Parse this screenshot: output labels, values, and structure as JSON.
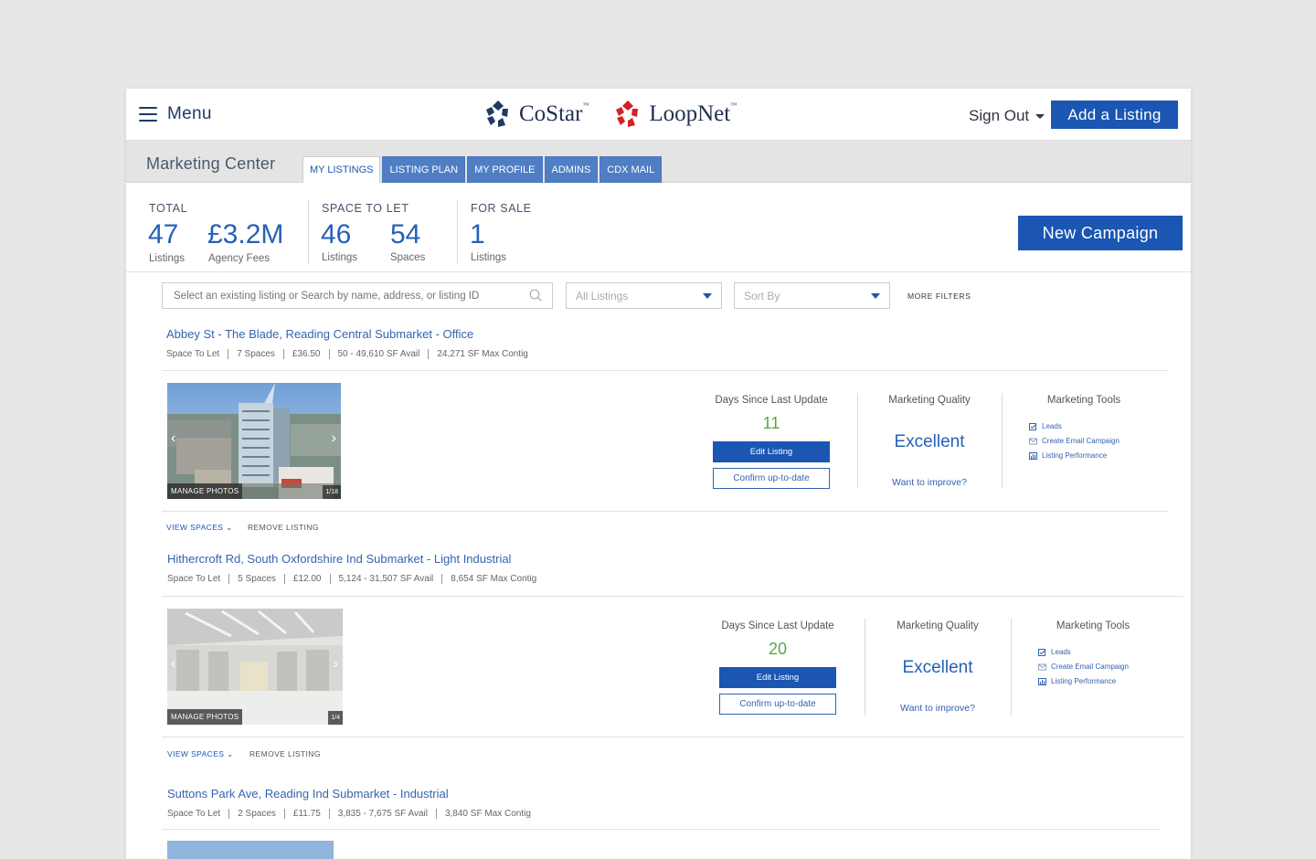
{
  "nav": {
    "menu_label": "Menu",
    "brand_costar": "CoStar",
    "brand_loopnet": "LoopNet",
    "tm": "™",
    "sign_out": "Sign Out",
    "add_listing": "Add a Listing"
  },
  "marketing_center": {
    "title": "Marketing Center",
    "tabs": [
      {
        "label": "MY LISTINGS",
        "active": true
      },
      {
        "label": "LISTING PLAN",
        "active": false
      },
      {
        "label": "MY PROFILE",
        "active": false
      },
      {
        "label": "ADMINS",
        "active": false
      },
      {
        "label": "CDX MAIL",
        "active": false
      }
    ]
  },
  "stats": {
    "total_label": "TOTAL",
    "total_listings": "47",
    "total_listings_label": "Listings",
    "agency_fees": "£3.2M",
    "agency_fees_label": "Agency Fees",
    "space_label": "SPACE TO LET",
    "space_listings": "46",
    "space_listings_label": "Listings",
    "space_spaces": "54",
    "space_spaces_label": "Spaces",
    "sale_label": "FOR SALE",
    "sale_listings": "1",
    "sale_listings_label": "Listings",
    "new_campaign": "New Campaign"
  },
  "filters": {
    "search_placeholder": "Select an existing listing or Search by name, address, or listing ID",
    "listings_select": "All Listings",
    "sort_select": "Sort By",
    "more_filters": "MORE FILTERS"
  },
  "columns": {
    "days_label": "Days Since Last Update",
    "quality_label": "Marketing Quality",
    "tools_label": "Marketing Tools",
    "edit_listing": "Edit Listing",
    "confirm": "Confirm up-to-date",
    "improve": "Want to improve?",
    "tools": [
      "Leads",
      "Create Email Campaign",
      "Listing Performance"
    ],
    "manage_photos": "MANAGE PHOTOS",
    "view_spaces": "VIEW SPACES",
    "remove_listing": "REMOVE LISTING"
  },
  "listings": [
    {
      "title": "Abbey St - The Blade, Reading Central Submarket - Office",
      "meta": [
        "Space To Let",
        "7 Spaces",
        "£36.50",
        "50 - 49,610 SF Avail",
        "24,271 SF Max Contig"
      ],
      "days": "11",
      "quality": "Excellent",
      "photo_count": "1/18"
    },
    {
      "title": "Hithercroft Rd, South Oxfordshire Ind Submarket - Light Industrial",
      "meta": [
        "Space To Let",
        "5 Spaces",
        "£12.00",
        "5,124 - 31,507 SF Avail",
        "8,654 SF Max Contig"
      ],
      "days": "20",
      "quality": "Excellent",
      "photo_count": "1/4"
    },
    {
      "title": "Suttons Park Ave, Reading Ind Submarket - Industrial",
      "meta": [
        "Space To Let",
        "2 Spaces",
        "£11.75",
        "3,835 - 7,675 SF Avail",
        "3,840 SF Max Contig"
      ]
    }
  ],
  "colors": {
    "primary": "#1a56b2",
    "tab_blue": "#4f7ec4",
    "days_green": "#5aa641",
    "brand_navy": "#1f3b63",
    "loopnet_red": "#d42027"
  }
}
